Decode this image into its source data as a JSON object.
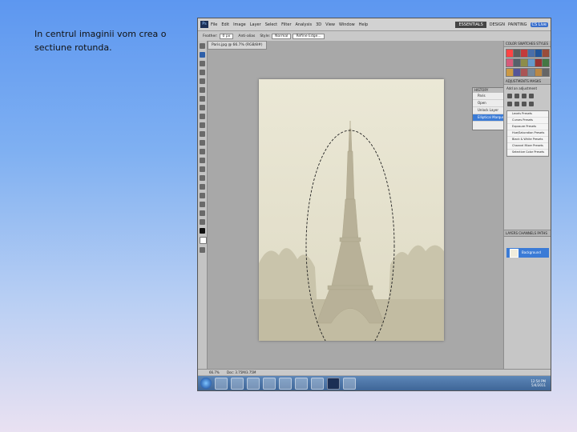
{
  "slide": {
    "text": "In centrul imaginii vom crea o sectiune rotunda."
  },
  "photoshop": {
    "logo": "Ps",
    "menu": [
      "File",
      "Edit",
      "Image",
      "Layer",
      "Select",
      "Filter",
      "Analysis",
      "3D",
      "View",
      "Window",
      "Help"
    ],
    "workspaces": {
      "active": "ESSENTIALS",
      "design": "DESIGN",
      "painting": "PAINTING",
      "cs_live": "CS Live"
    },
    "options": {
      "feather_label": "Feather:",
      "feather_value": "0 px",
      "antialias": "Anti-alias",
      "style_label": "Style:",
      "style_value": "Normal",
      "refine": "Refine Edge..."
    },
    "document_tab": "Paris.jpg @ 66.7% (RGB/8#)",
    "history": {
      "title": "HISTORY",
      "items": [
        "Paris",
        "Open",
        "Unlock Layer",
        "Elliptical Marquee"
      ]
    },
    "panels": {
      "top_tabs": "COLOR  SWATCHES  STYLES",
      "adjust_tabs": "ADJUSTMENTS  MASKS",
      "adjust_title": "Add an adjustment",
      "presets": [
        "Levels Presets",
        "Curves Presets",
        "Exposure Presets",
        "Hue/Saturation Presets",
        "Black & White Presets",
        "Channel Mixer Presets",
        "Selective Color Presets"
      ],
      "layers_tabs": "LAYERS  CHANNELS  PATHS",
      "layer_name": "Background"
    },
    "status": {
      "zoom": "66.7%",
      "doc": "Doc: 3.75M/3.75M"
    },
    "taskbar": {
      "time": "12:54 PM",
      "date": "5/4/2011"
    }
  },
  "colors": {
    "accent_selection": "#3b7bd6",
    "canvas_sepia": "#e8e5d2",
    "swatches": [
      "#ff4444",
      "#5e5e5e",
      "#c43b3b",
      "#4a6ea8",
      "#22559a",
      "#9a4c3a",
      "#d65c7b",
      "#55606b",
      "#8d8d4a",
      "#6699cc",
      "#993333",
      "#447744",
      "#cc9944",
      "#555599",
      "#aa5555",
      "#778899",
      "#bb8844",
      "#666666"
    ]
  }
}
